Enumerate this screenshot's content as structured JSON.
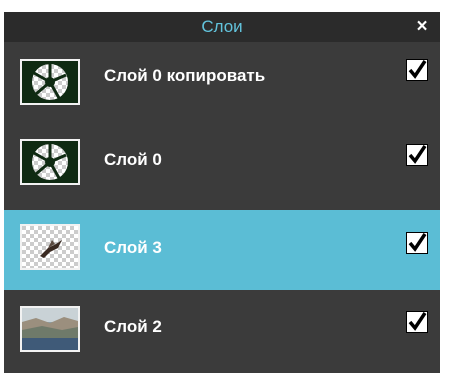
{
  "panel": {
    "title": "Слои",
    "close_label": "×"
  },
  "layers": [
    {
      "name": "Слой 0 копировать",
      "visible": true,
      "selected": false,
      "thumbnail": "shattered-circle-dark"
    },
    {
      "name": "Слой 0",
      "visible": true,
      "selected": false,
      "thumbnail": "shattered-circle-dark"
    },
    {
      "name": "Слой 3",
      "visible": true,
      "selected": true,
      "thumbnail": "small-object-transparent"
    },
    {
      "name": "Слой 2",
      "visible": true,
      "selected": false,
      "thumbnail": "landscape-photo"
    }
  ],
  "colors": {
    "panel_bg": "#3b3b3b",
    "titlebar_bg": "#2b2b2b",
    "title_text": "#62c3dc",
    "selected_bg": "#5bbdd5",
    "checkmark": "#000000"
  },
  "icons": {
    "close": "close-icon",
    "visibility": "checkbox-check-icon"
  }
}
